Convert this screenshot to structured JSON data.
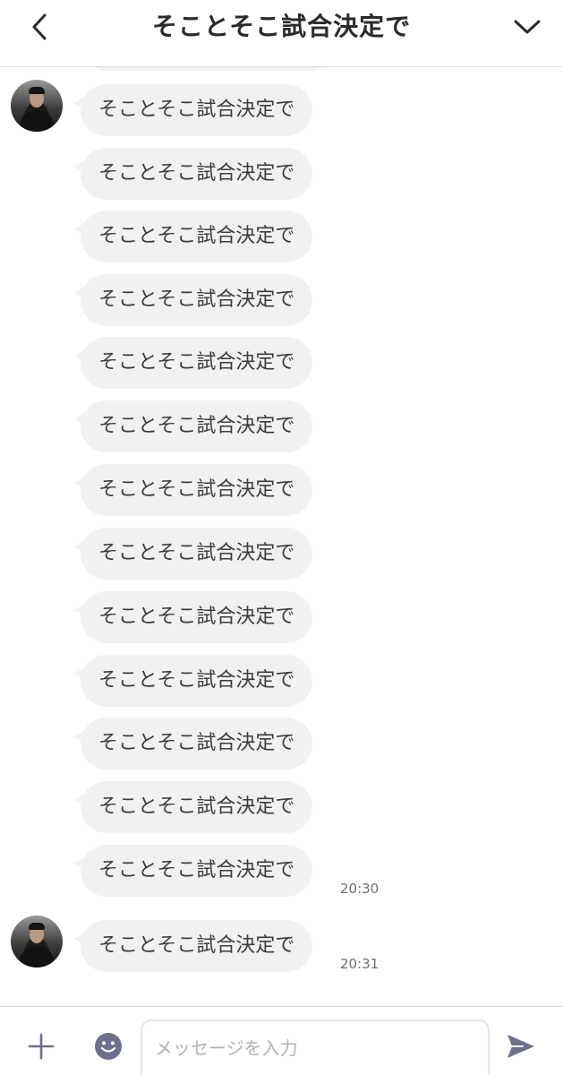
{
  "header": {
    "title": "そことそこ試合決定で",
    "back_icon": "chevron-left-icon",
    "menu_icon": "chevron-down-icon"
  },
  "messages": [
    {
      "text": "そことそこ試合決定で",
      "show_avatar": true,
      "time": ""
    },
    {
      "text": "そことそこ試合決定で",
      "show_avatar": false,
      "time": ""
    },
    {
      "text": "そことそこ試合決定で",
      "show_avatar": false,
      "time": ""
    },
    {
      "text": "そことそこ試合決定で",
      "show_avatar": false,
      "time": ""
    },
    {
      "text": "そことそこ試合決定で",
      "show_avatar": false,
      "time": ""
    },
    {
      "text": "そことそこ試合決定で",
      "show_avatar": false,
      "time": ""
    },
    {
      "text": "そことそこ試合決定で",
      "show_avatar": false,
      "time": ""
    },
    {
      "text": "そことそこ試合決定で",
      "show_avatar": false,
      "time": ""
    },
    {
      "text": "そことそこ試合決定で",
      "show_avatar": false,
      "time": ""
    },
    {
      "text": "そことそこ試合決定で",
      "show_avatar": false,
      "time": ""
    },
    {
      "text": "そことそこ試合決定で",
      "show_avatar": false,
      "time": ""
    },
    {
      "text": "そことそこ試合決定で",
      "show_avatar": false,
      "time": ""
    },
    {
      "text": "そことそこ試合決定で",
      "show_avatar": false,
      "time": "20:30"
    },
    {
      "text": "そことそこ試合決定で",
      "show_avatar": true,
      "time": "20:31"
    }
  ],
  "input_bar": {
    "placeholder": "メッセージを入力",
    "plus_icon": "plus-icon",
    "emoji_icon": "emoji-icon",
    "send_icon": "send-icon"
  },
  "colors": {
    "bubble": "#f1f1f3",
    "icon": "#2b2b2b",
    "accent_icon": "#6e6f8c",
    "time_text": "#6f6f73"
  }
}
